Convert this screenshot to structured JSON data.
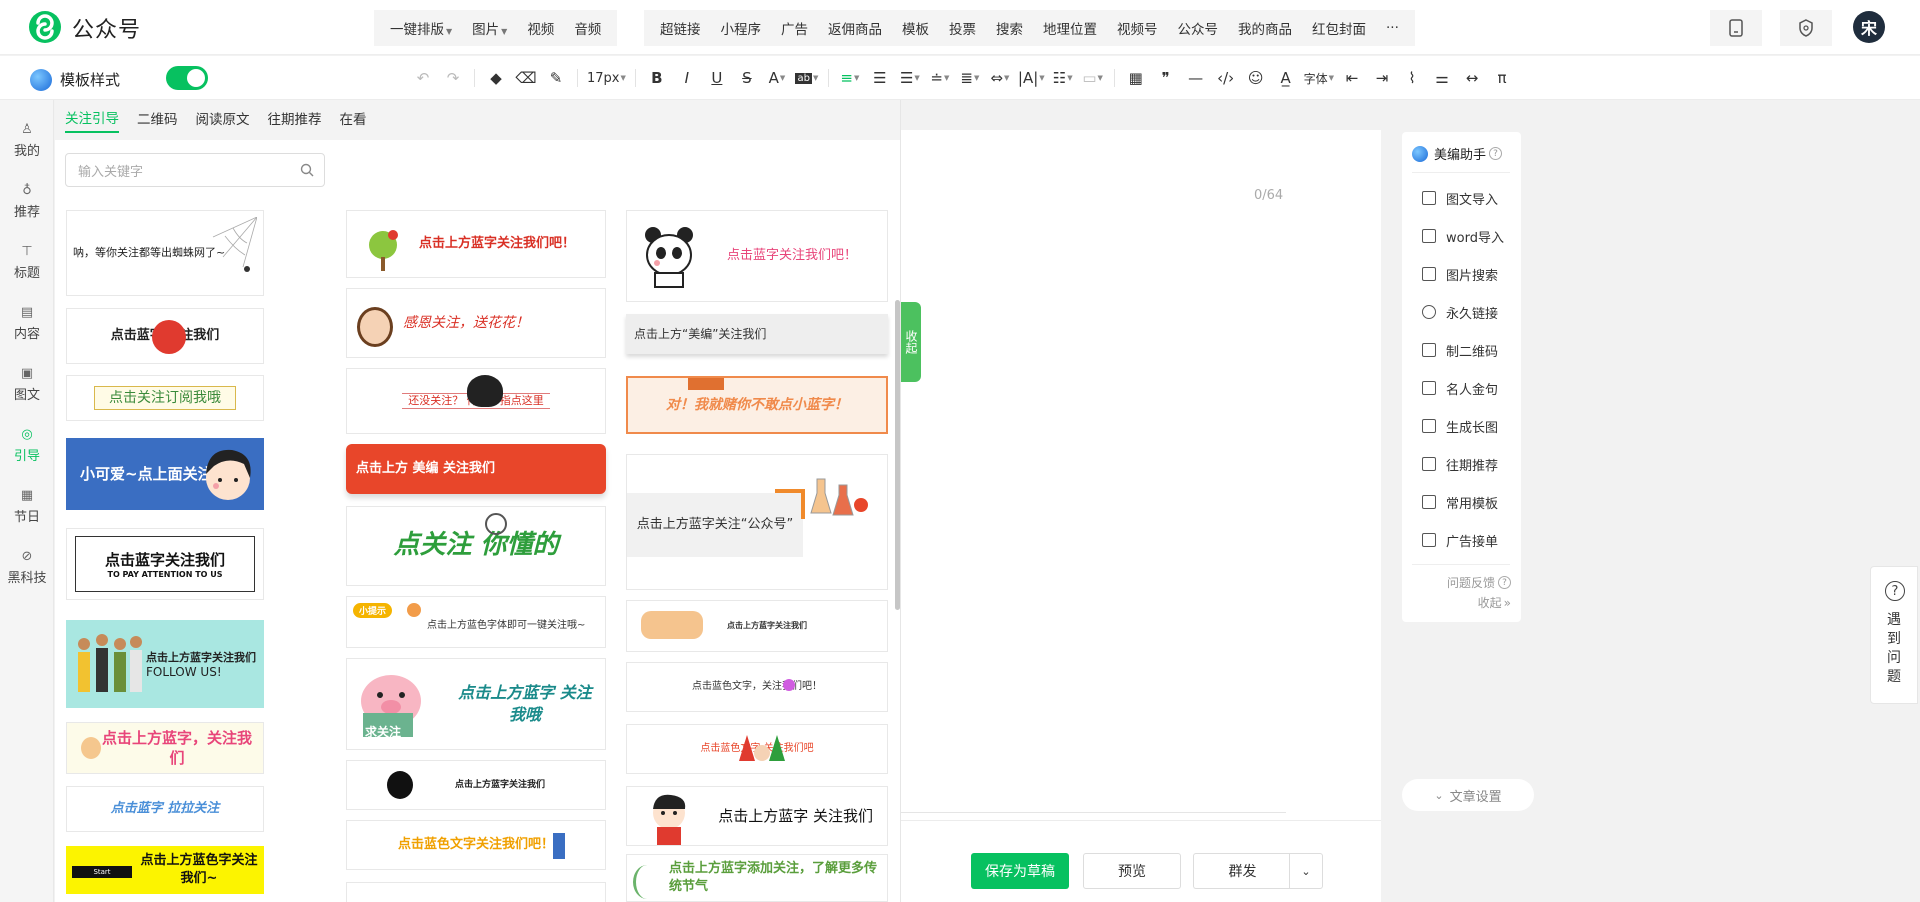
{
  "app": {
    "brand": "公众号"
  },
  "menu1": [
    {
      "label": "一键排版",
      "caret": true
    },
    {
      "label": "图片",
      "caret": true
    },
    {
      "label": "视频",
      "caret": false
    },
    {
      "label": "音频",
      "caret": false
    }
  ],
  "menu2": [
    "超链接",
    "小程序",
    "广告",
    "返佣商品",
    "模板",
    "投票",
    "搜索",
    "地理位置",
    "视频号",
    "公众号",
    "我的商品",
    "红包封面",
    "···"
  ],
  "user": {
    "avatar_text": "宋"
  },
  "toolbar": {
    "template_label": "模板样式",
    "template_toggle_on": true,
    "font_size": "17px",
    "font_label": "字体"
  },
  "rail": [
    {
      "label": "我的",
      "icon": "user-icon"
    },
    {
      "label": "推荐",
      "icon": "lightbulb-icon"
    },
    {
      "label": "标题",
      "icon": "title-icon"
    },
    {
      "label": "内容",
      "icon": "content-icon"
    },
    {
      "label": "图文",
      "icon": "image-text-icon"
    },
    {
      "label": "引导",
      "icon": "guide-icon",
      "active": true
    },
    {
      "label": "节日",
      "icon": "calendar-icon"
    },
    {
      "label": "黑科技",
      "icon": "tech-icon"
    }
  ],
  "panel": {
    "tabs": [
      "关注引导",
      "二维码",
      "阅读原文",
      "往期推荐",
      "在看"
    ],
    "active_tab": 0,
    "search_placeholder": "输入关键字"
  },
  "templates": {
    "col1": [
      "呐，等你关注都等出蜘蛛网了~",
      "点击蓝字 关注我们",
      "点击关注订阅我哦",
      "小可爱~点上面关注我",
      "点击蓝字关注我们",
      "TO PAY ATTENTION TO US",
      "点击上方蓝字关注我们",
      "FOLLOW US!",
      "点击上方蓝字，关注我们",
      "点击蓝字 拉拉关注",
      "点击上方蓝色字关注我们~",
      "Start"
    ],
    "col2": [
      "点击上方蓝字关注我们吧！",
      "感恩关注，送花花！",
      "还没关注？ 伸出中指点这里",
      "点击上方 美编 关注我们",
      "点关注 你懂的",
      "小提示",
      "点击上方蓝色字体即可一键关注哦~",
      "点击上方蓝字 关注我哦",
      "求关注",
      "点击上方蓝字关注我们",
      "点击蓝色文字关注我们吧！"
    ],
    "col3": [
      "点击蓝字关注我们吧！",
      "点击上方“美编”关注我们",
      "对！我就赌你不敢点小蓝字！",
      "点击上方蓝字关注“公众号”",
      "点击上方蓝字关注我们",
      "点击蓝色文字，关注我们吧！",
      "点击蓝色文字 关注我们吧",
      "点击上方蓝字 关注我们",
      "点击上方蓝字添加关注，了解更多传统节气"
    ]
  },
  "editor": {
    "title_counter": "0/64",
    "collapse_label": "收起"
  },
  "footer": {
    "save": "保存为草稿",
    "preview": "预览",
    "send": "群发"
  },
  "assistant": {
    "title": "美编助手",
    "items": [
      {
        "label": "图文导入",
        "icon": "import-icon"
      },
      {
        "label": "word导入",
        "icon": "word-icon"
      },
      {
        "label": "图片搜索",
        "icon": "image-search-icon"
      },
      {
        "label": "永久链接",
        "icon": "link-icon"
      },
      {
        "label": "制二维码",
        "icon": "qrcode-icon"
      },
      {
        "label": "名人金句",
        "icon": "quote-icon"
      },
      {
        "label": "生成长图",
        "icon": "long-image-icon"
      },
      {
        "label": "往期推荐",
        "icon": "history-icon"
      },
      {
        "label": "常用模板",
        "icon": "template-icon"
      },
      {
        "label": "广告接单",
        "icon": "ad-icon"
      }
    ],
    "feedback": "问题反馈",
    "collapse": "收起",
    "article_settings": "文章设置"
  },
  "help": {
    "text": "遇到问题"
  },
  "colors": {
    "accent": "#07c160",
    "red_banner": "#e8462a",
    "dark_blue_banner": "#3b6fc4"
  }
}
